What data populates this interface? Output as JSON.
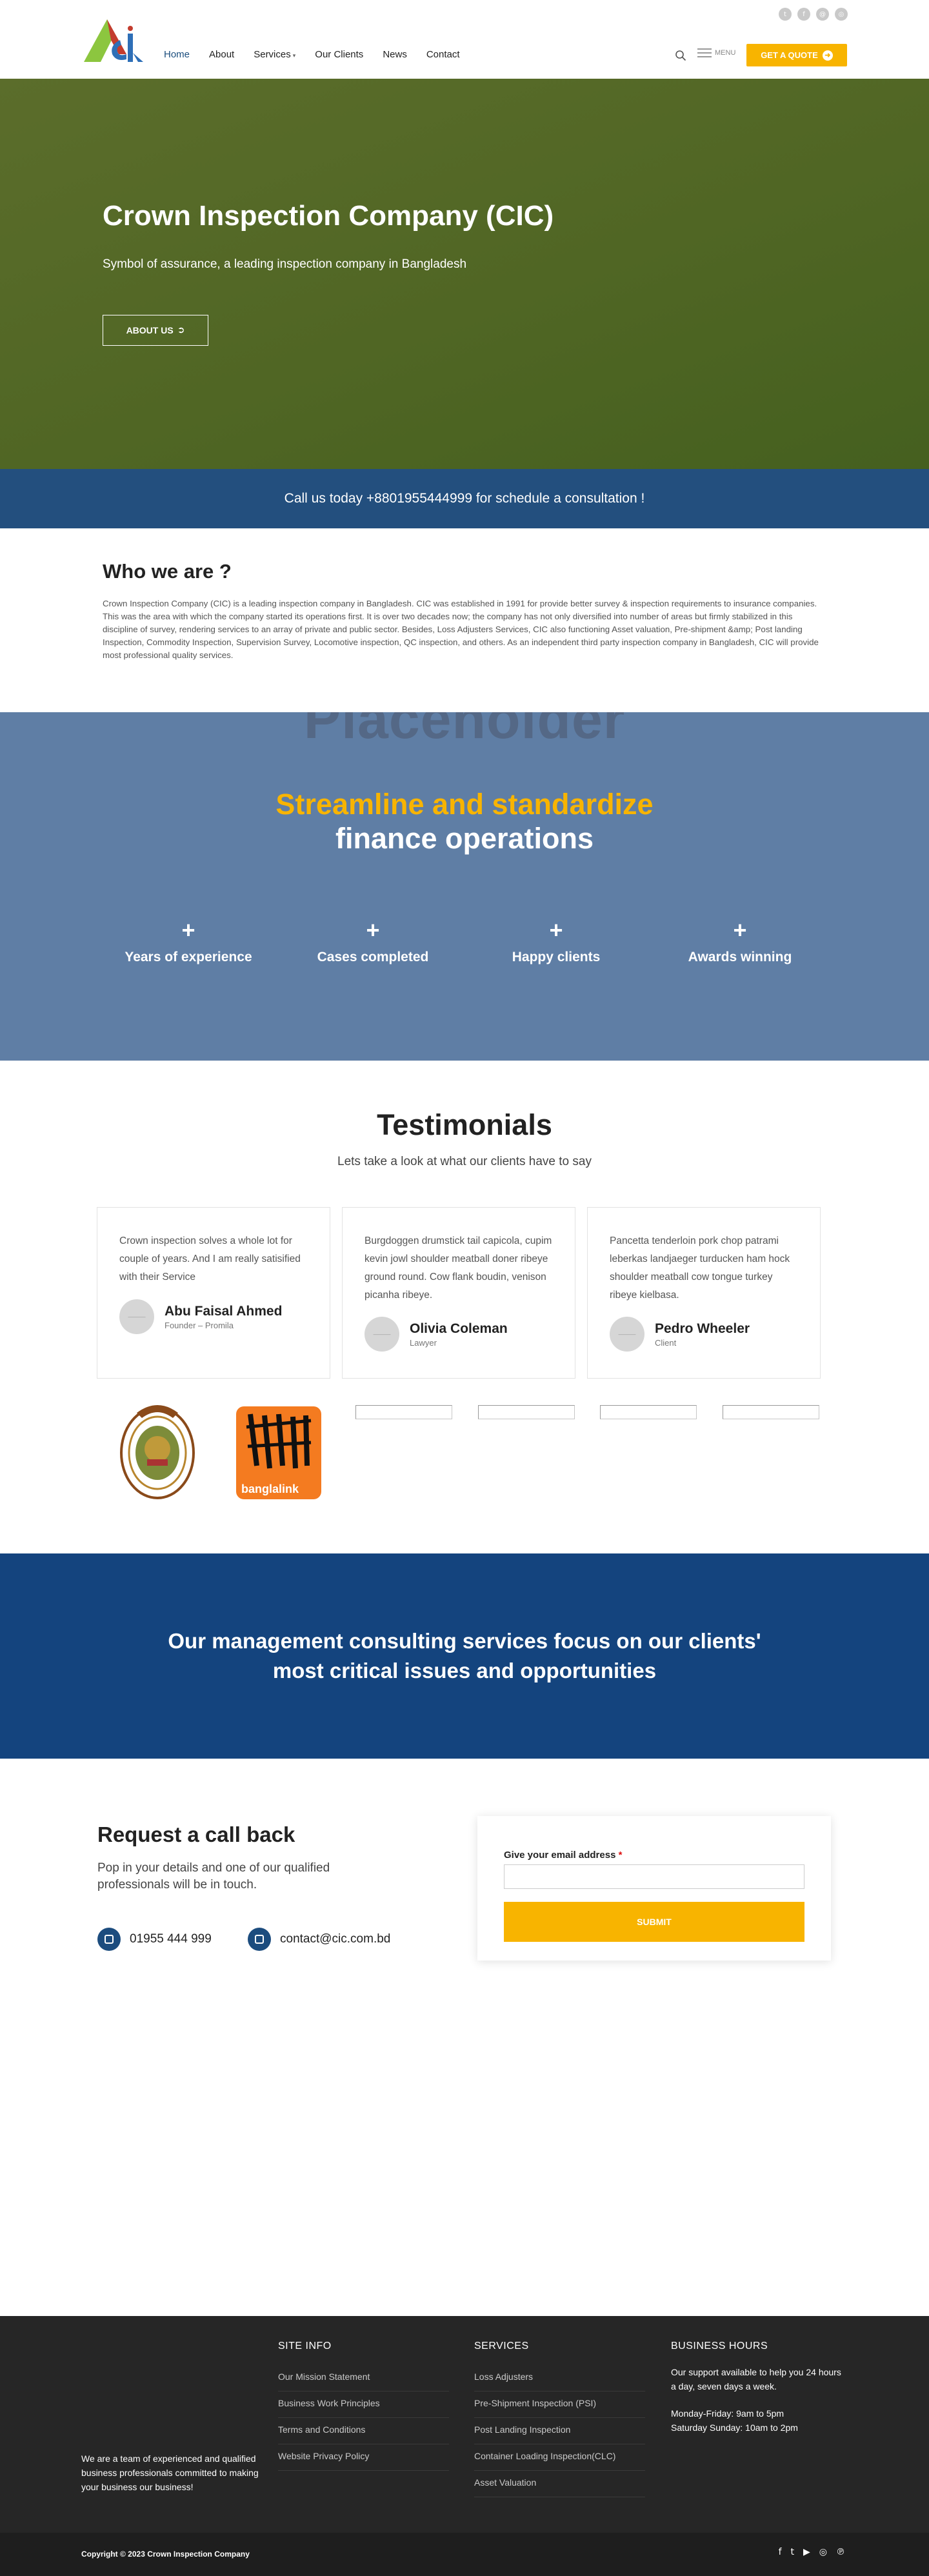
{
  "header": {
    "social_icons": [
      "twitter-icon",
      "facebook-icon",
      "email-icon",
      "instagram-icon"
    ],
    "social_glyphs": [
      "t",
      "f",
      "@",
      "◎"
    ],
    "nav": [
      "Home",
      "About",
      "Services",
      "Our Clients",
      "News",
      "Contact"
    ],
    "menu_label": "MENU",
    "quote_label": "GET A QUOTE"
  },
  "hero": {
    "title": "Crown Inspection Company (CIC)",
    "subtitle": "Symbol of assurance, a leading inspection company in Bangladesh",
    "button": "ABOUT US"
  },
  "callbar": {
    "text": "Call us today +8801955444999 for schedule a consultation !"
  },
  "who": {
    "title": "Who we are ?",
    "body": "Crown Inspection Company (CIC) is a leading inspection company in Bangladesh. CIC was established in 1991 for provide better survey & inspection requirements to insurance companies. This was the area with which the company started its operations first. It is over two decades now; the company has not only diversified into number of areas but firmly stabilized in this discipline of survey, rendering services to an array of private and public sector. Besides, Loss Adjusters Services, CIC also functioning Asset valuation, Pre-shipment &amp; Post landing Inspection, Commodity Inspection, Supervision Survey, Locomotive inspection, QC inspection, and others. As an independent third party inspection company in Bangladesh, CIC will provide most professional quality services."
  },
  "stats": {
    "ghost": "Placeholder",
    "headline_1": "Streamline and standardize",
    "headline_2": "finance operations",
    "items": [
      "Years of experience",
      "Cases completed",
      "Happy clients",
      "Awards winning"
    ],
    "plus": "+"
  },
  "testimonials": {
    "title": "Testimonials",
    "subtitle": "Lets take a look at what our clients have to say",
    "items": [
      {
        "quote": "Crown inspection solves a whole lot for couple of years. And I am really satisified with their Service",
        "name": "Abu Faisal Ahmed",
        "role": "Founder – Promila"
      },
      {
        "quote": "Burgdoggen drumstick tail capicola, cupim kevin jowl shoulder meatball doner ribeye ground round. Cow flank boudin, venison picanha ribeye.",
        "name": "Olivia Coleman",
        "role": "Lawyer"
      },
      {
        "quote": "Pancetta tenderloin pork chop patrami leberkas landjaeger turducken ham hock shoulder meatball cow tongue turkey ribeye kielbasa.",
        "name": "Pedro Wheeler",
        "role": "Client"
      }
    ]
  },
  "clients": {
    "banglalink": "banglalink"
  },
  "mgmt": {
    "text": "Our management consulting services focus on our clients' most critical issues and opportunities"
  },
  "request": {
    "title": "Request a call back",
    "subtitle": "Pop in your details and one of our qualified professionals will be in touch.",
    "phone": "01955 444 999",
    "email": "contact@cic.com.bd",
    "form_label": "Give your email address",
    "required": "*",
    "submit": "SUBMIT"
  },
  "footer": {
    "about": "We are a team of experienced and qualified business professionals committed to making your business our business!",
    "site_info_title": "SITE INFO",
    "site_info": [
      "Our Mission Statement",
      "Business Work Principles",
      "Terms and Conditions",
      "Website Privacy Policy"
    ],
    "services_title": "SERVICES",
    "services": [
      "Loss Adjusters",
      "Pre-Shipment Inspection (PSI)",
      "Post Landing Inspection",
      "Container Loading Inspection(CLC)",
      "Asset Valuation"
    ],
    "hours_title": "BUSINESS HOURS",
    "hours_text": "Our support available to help you 24 hours a day, seven days a week.",
    "hours_1": "Monday-Friday: 9am to 5pm",
    "hours_2": "Saturday Sunday: 10am to 2pm",
    "copyright": "Copyright © 2023 Crown Inspection Company",
    "social_icons": [
      "facebook-icon",
      "twitter-icon",
      "youtube-icon",
      "instagram-icon",
      "pinterest-icon"
    ],
    "social_glyphs": [
      "f",
      "t",
      "▶",
      "◎",
      "℗"
    ]
  },
  "colors": {
    "brand_blue": "#234f7e",
    "accent": "#f8b400",
    "hero_green": "#506624",
    "navy": "#14447e"
  }
}
